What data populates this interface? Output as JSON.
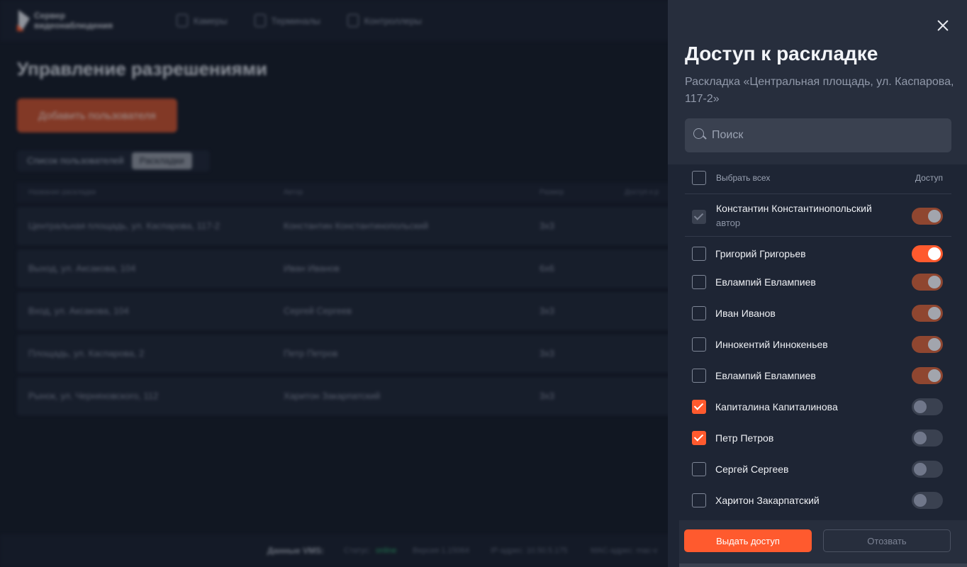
{
  "app": {
    "logo_line1": "Сервер",
    "logo_line2": "видеонаблюдения",
    "nav": [
      "Камеры",
      "Терминалы",
      "Контроллеры"
    ],
    "page_title": "Управление разрешениями",
    "add_user_label": "Добавить пользователя",
    "tabs": [
      "Список пользователей",
      "Раскладки"
    ],
    "active_tab": "Раскладки",
    "table": {
      "columns": [
        "Название раскладки",
        "Автор",
        "Размер",
        "Доступ к р"
      ],
      "rows": [
        {
          "name": "Центральная площадь, ул. Каспарова, 117-2",
          "author": "Константин Константинопольский",
          "size": "3x3"
        },
        {
          "name": "Выход, ул. Аксакова, 104",
          "author": "Иван Иванов",
          "size": "6x6"
        },
        {
          "name": "Вход, ул. Аксакова, 104",
          "author": "Сергей Сергеев",
          "size": "3x3"
        },
        {
          "name": "Площадь, ул. Каспарова, 2",
          "author": "Петр Петров",
          "size": "3x3"
        },
        {
          "name": "Рынок, ул. Черняховского, 112",
          "author": "Харитон Закарпатский",
          "size": "3x3"
        }
      ]
    },
    "footer": {
      "label": "Данные VMS:",
      "status_label": "Статус:",
      "status_value": "online",
      "version": "Версия 1.15064",
      "ip": "IP-адрес: 10.50.5.175",
      "mac": "MAC-адрес: mac-v"
    }
  },
  "panel": {
    "title": "Доступ к раскладке",
    "subtitle": "Раскладка «Центральная площадь, ул. Каспарова, 117-2»",
    "search_placeholder": "Поиск",
    "select_all_label": "Выбрать всех",
    "access_header": "Доступ",
    "author": {
      "name": "Константин Константинопольский",
      "role": "автор",
      "access": "on-dim"
    },
    "users": [
      {
        "name": "Григорий Григорьев",
        "checked": false,
        "access": "on"
      },
      {
        "name": "Евлампий Евлампиев",
        "checked": false,
        "access": "on-dim"
      },
      {
        "name": "Иван Иванов",
        "checked": false,
        "access": "on-dim"
      },
      {
        "name": "Иннокентий Иннокеньев",
        "checked": false,
        "access": "on-dim"
      },
      {
        "name": "Евлампий Евлампиев",
        "checked": false,
        "access": "on-dim"
      },
      {
        "name": "Капиталина Капиталинова",
        "checked": true,
        "access": "off"
      },
      {
        "name": "Петр Петров",
        "checked": true,
        "access": "off"
      },
      {
        "name": "Сергей Сергеев",
        "checked": false,
        "access": "off"
      },
      {
        "name": "Харитон Закарпатский",
        "checked": false,
        "access": "off"
      }
    ],
    "grant_label": "Выдать доступ",
    "revoke_label": "Отозвать"
  },
  "colors": {
    "accent": "#ff5a2e",
    "panel_bg": "#1e2534",
    "page_bg": "#161c29",
    "online": "#2eab6b"
  }
}
